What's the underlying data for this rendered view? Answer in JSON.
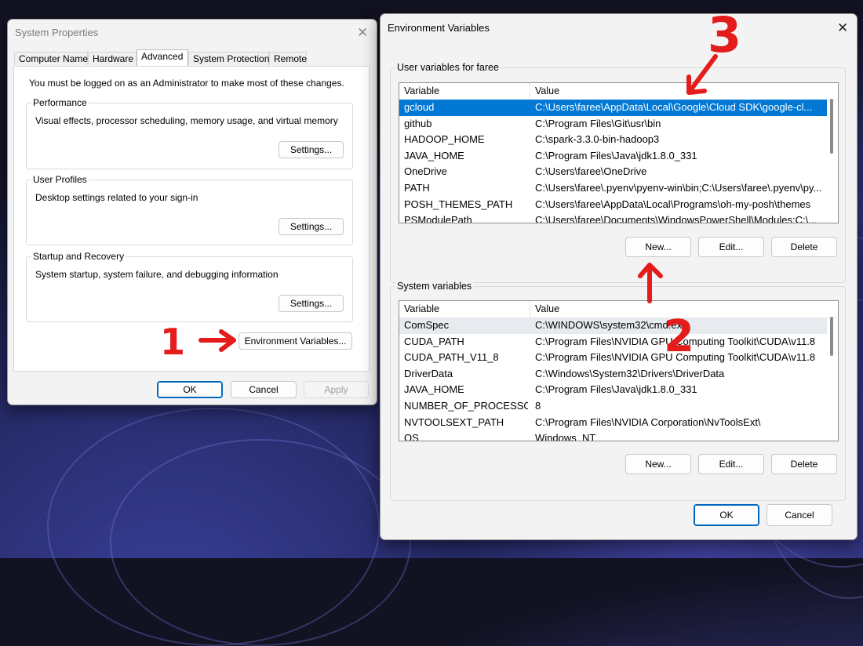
{
  "system_properties": {
    "title": "System Properties",
    "tabs": [
      "Computer Name",
      "Hardware",
      "Advanced",
      "System Protection",
      "Remote"
    ],
    "active_tab": "Advanced",
    "admin_note": "You must be logged on as an Administrator to make most of these changes.",
    "performance": {
      "label": "Performance",
      "desc": "Visual effects, processor scheduling, memory usage, and virtual memory",
      "button": "Settings..."
    },
    "user_profiles": {
      "label": "User Profiles",
      "desc": "Desktop settings related to your sign-in",
      "button": "Settings..."
    },
    "startup_recovery": {
      "label": "Startup and Recovery",
      "desc": "System startup, system failure, and debugging information",
      "button": "Settings..."
    },
    "env_vars_button": "Environment Variables...",
    "ok": "OK",
    "cancel": "Cancel",
    "apply": "Apply"
  },
  "env_vars": {
    "title": "Environment Variables",
    "user_section": "User variables for faree",
    "system_section": "System variables",
    "col_variable": "Variable",
    "col_value": "Value",
    "user_rows": [
      {
        "name": "gcloud",
        "value": "C:\\Users\\faree\\AppData\\Local\\Google\\Cloud SDK\\google-cl..."
      },
      {
        "name": "github",
        "value": "C:\\Program Files\\Git\\usr\\bin"
      },
      {
        "name": "HADOOP_HOME",
        "value": "C:\\spark-3.3.0-bin-hadoop3"
      },
      {
        "name": "JAVA_HOME",
        "value": "C:\\Program Files\\Java\\jdk1.8.0_331"
      },
      {
        "name": "OneDrive",
        "value": "C:\\Users\\faree\\OneDrive"
      },
      {
        "name": "PATH",
        "value": "C:\\Users\\faree\\.pyenv\\pyenv-win\\bin;C:\\Users\\faree\\.pyenv\\py..."
      },
      {
        "name": "POSH_THEMES_PATH",
        "value": "C:\\Users\\faree\\AppData\\Local\\Programs\\oh-my-posh\\themes"
      },
      {
        "name": "PSModulePath",
        "value": "C:\\Users\\faree\\Documents\\WindowsPowerShell\\Modules;C:\\..."
      }
    ],
    "system_rows": [
      {
        "name": "ComSpec",
        "value": "C:\\WINDOWS\\system32\\cmd.exe"
      },
      {
        "name": "CUDA_PATH",
        "value": "C:\\Program Files\\NVIDIA GPU Computing Toolkit\\CUDA\\v11.8"
      },
      {
        "name": "CUDA_PATH_V11_8",
        "value": "C:\\Program Files\\NVIDIA GPU Computing Toolkit\\CUDA\\v11.8"
      },
      {
        "name": "DriverData",
        "value": "C:\\Windows\\System32\\Drivers\\DriverData"
      },
      {
        "name": "JAVA_HOME",
        "value": "C:\\Program Files\\Java\\jdk1.8.0_331"
      },
      {
        "name": "NUMBER_OF_PROCESSORS",
        "value": "8"
      },
      {
        "name": "NVTOOLSEXT_PATH",
        "value": "C:\\Program Files\\NVIDIA Corporation\\NvToolsExt\\"
      },
      {
        "name": "OS",
        "value": "Windows_NT"
      }
    ],
    "new": "New...",
    "edit": "Edit...",
    "delete": "Delete",
    "ok": "OK",
    "cancel": "Cancel"
  },
  "annotations": {
    "step1": "1",
    "step2": "2",
    "step3": "3",
    "color": "#e41c1c"
  },
  "icons": {
    "close": "close-icon",
    "arrow": "arrow-annotation"
  }
}
